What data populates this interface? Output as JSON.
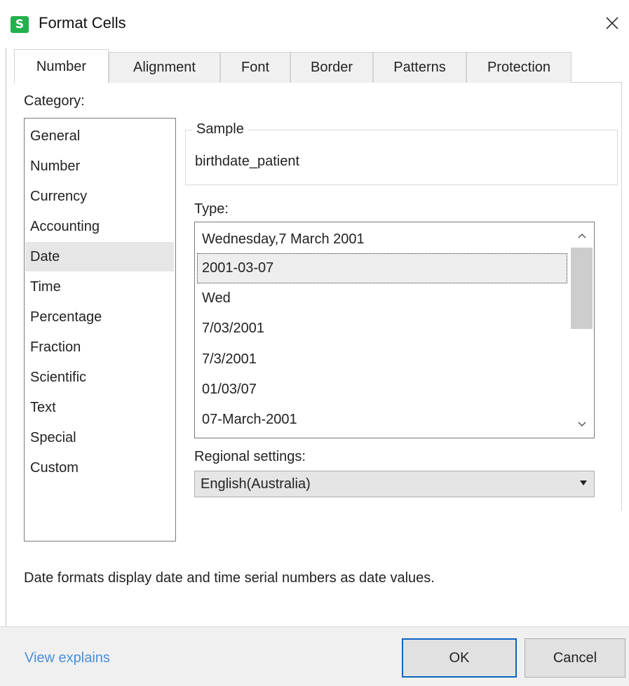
{
  "window": {
    "title": "Format Cells",
    "app_icon_letter": "S",
    "app_icon_color": "#22b14c"
  },
  "tabs": [
    {
      "label": "Number",
      "active": true
    },
    {
      "label": "Alignment"
    },
    {
      "label": "Font"
    },
    {
      "label": "Border"
    },
    {
      "label": "Patterns"
    },
    {
      "label": "Protection"
    }
  ],
  "category": {
    "label": "Category:",
    "items": [
      "General",
      "Number",
      "Currency",
      "Accounting",
      "Date",
      "Time",
      "Percentage",
      "Fraction",
      "Scientific",
      "Text",
      "Special",
      "Custom"
    ],
    "selected": "Date"
  },
  "sample": {
    "label": "Sample",
    "value": "birthdate_patient"
  },
  "type": {
    "label": "Type:",
    "items": [
      "Wednesday,7 March 2001",
      "2001-03-07",
      "Wed",
      "7/03/2001",
      "7/3/2001",
      "01/03/07",
      "07-March-2001"
    ],
    "selected": "2001-03-07"
  },
  "regional": {
    "label": "Regional settings:",
    "value": "English(Australia)"
  },
  "description": "Date formats display date and time serial numbers as date values.",
  "footer": {
    "view_explains": "View explains",
    "ok": "OK",
    "cancel": "Cancel",
    "link_color": "#4a8fd8",
    "ok_border_color": "#0a64c8"
  }
}
